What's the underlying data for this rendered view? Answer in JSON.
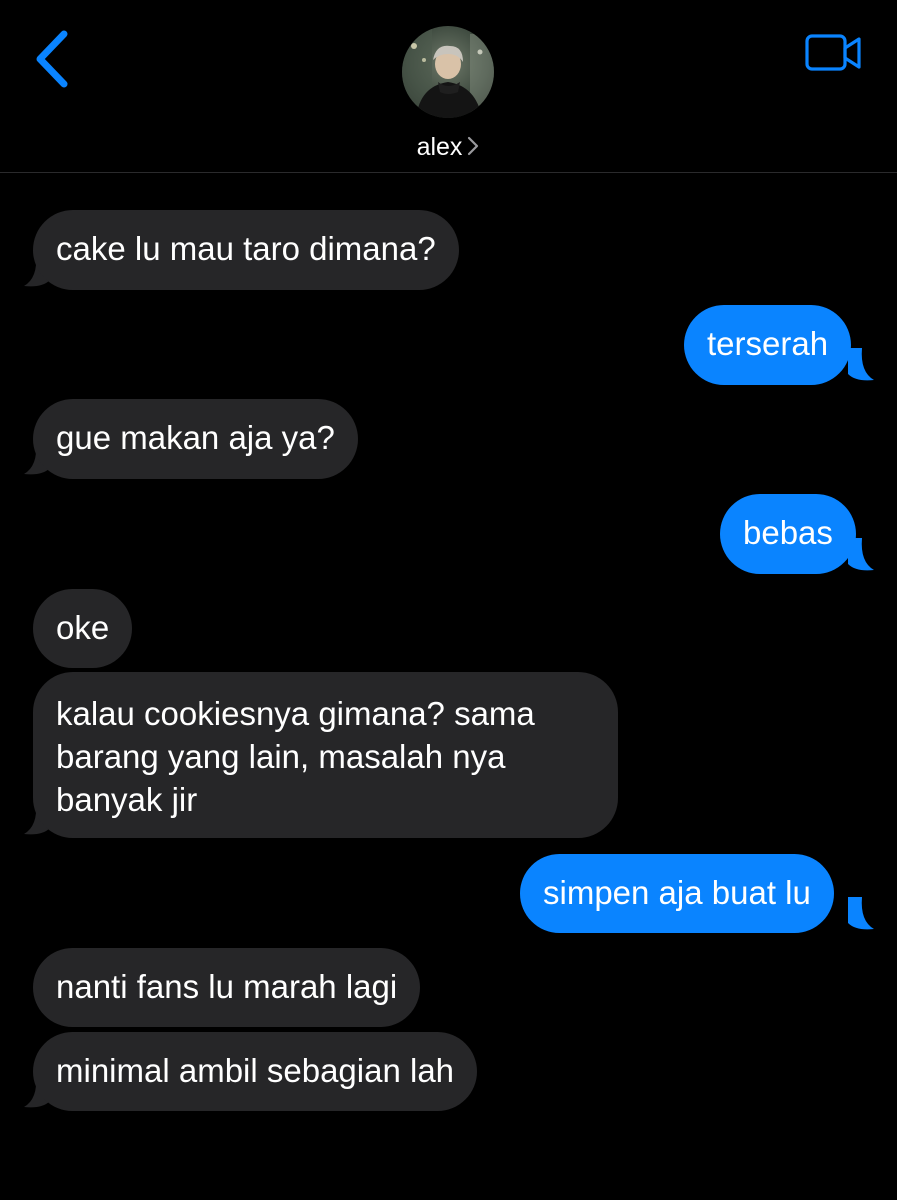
{
  "header": {
    "contact_name": "alex",
    "back_icon": "chevron-left-icon",
    "video_icon": "video-camera-icon",
    "chevron_icon": "chevron-right-icon",
    "accent_color": "#0a84ff"
  },
  "colors": {
    "incoming_bubble": "#262628",
    "outgoing_bubble": "#0a84ff",
    "background": "#000000"
  },
  "messages": [
    {
      "direction": "incoming",
      "text": "cake lu mau taro dimana?"
    },
    {
      "direction": "outgoing",
      "text": "terserah"
    },
    {
      "direction": "incoming",
      "text": "gue makan aja ya?"
    },
    {
      "direction": "outgoing",
      "text": "bebas"
    },
    {
      "direction": "incoming",
      "text": "oke"
    },
    {
      "direction": "incoming",
      "lines": [
        "kalau cookiesnya gimana? sama",
        "barang yang lain, masalah nya",
        "banyak jir"
      ]
    },
    {
      "direction": "outgoing",
      "text": "simpen aja buat lu"
    },
    {
      "direction": "incoming",
      "text": "nanti fans lu marah lagi"
    },
    {
      "direction": "incoming",
      "text": "minimal ambil sebagian lah"
    }
  ]
}
